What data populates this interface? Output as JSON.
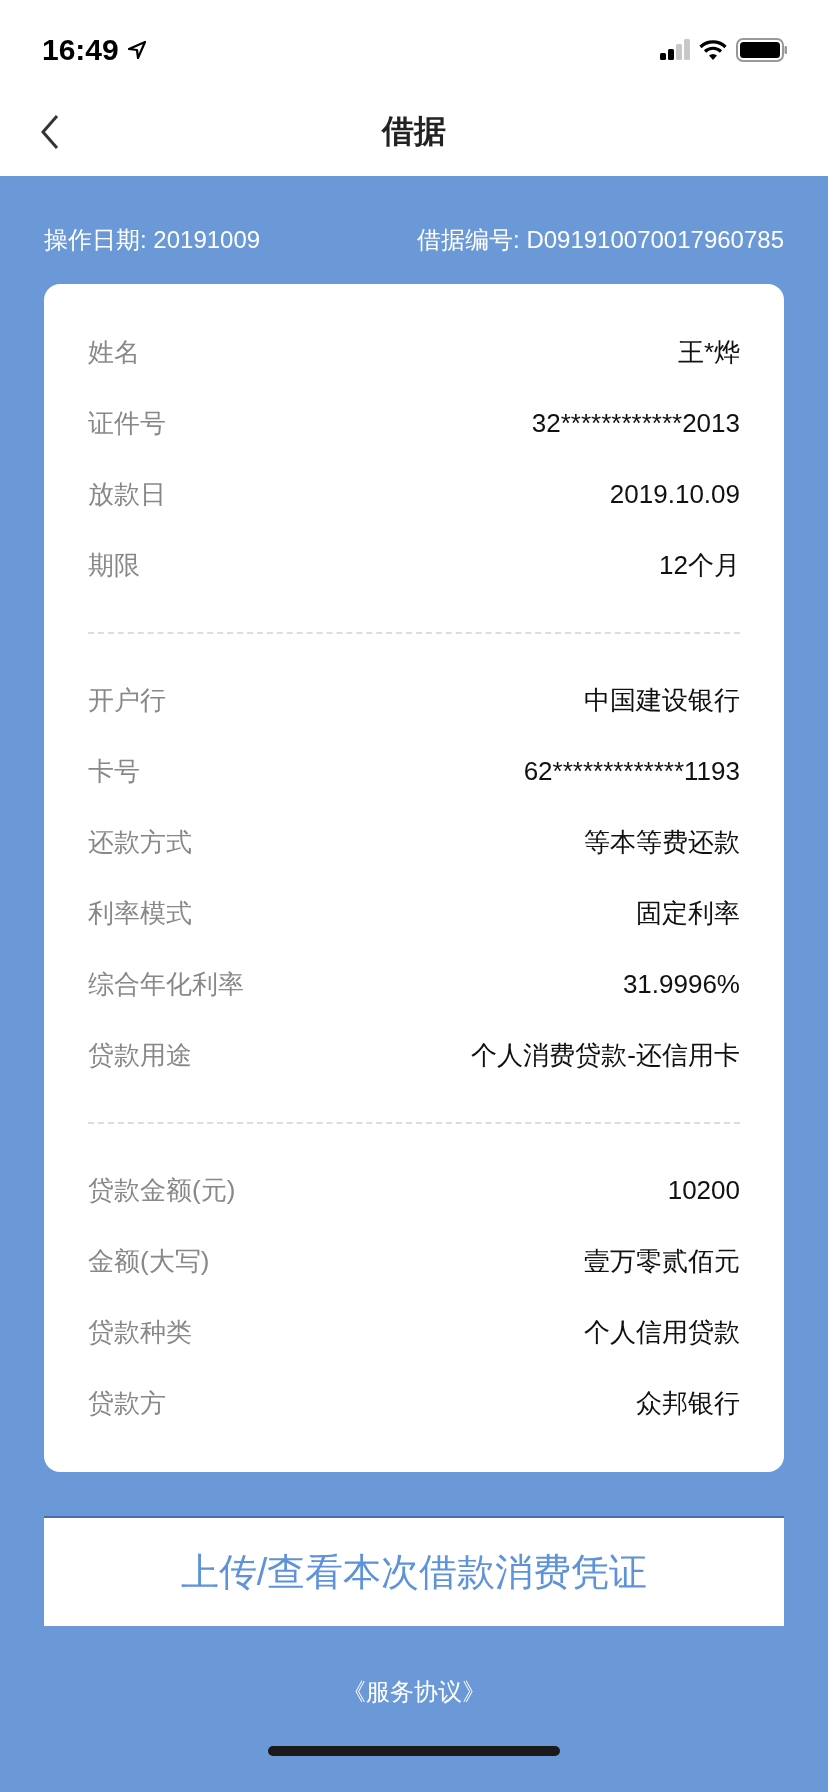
{
  "status_bar": {
    "time": "16:49"
  },
  "nav_bar": {
    "title": "借据"
  },
  "header": {
    "operation_date": "操作日期: 20191009",
    "receipt_number": "借据编号: D091910070017960785"
  },
  "sections": [
    {
      "rows": [
        {
          "label": "姓名",
          "value": "王*烨"
        },
        {
          "label": "证件号",
          "value": "32************2013"
        },
        {
          "label": "放款日",
          "value": "2019.10.09"
        },
        {
          "label": "期限",
          "value": "12个月"
        }
      ]
    },
    {
      "rows": [
        {
          "label": "开户行",
          "value": "中国建设银行"
        },
        {
          "label": "卡号",
          "value": "62*************1193"
        },
        {
          "label": "还款方式",
          "value": "等本等费还款"
        },
        {
          "label": "利率模式",
          "value": "固定利率"
        },
        {
          "label": "综合年化利率",
          "value": "31.9996%"
        },
        {
          "label": "贷款用途",
          "value": "个人消费贷款-还信用卡"
        }
      ]
    },
    {
      "rows": [
        {
          "label": "贷款金额(元)",
          "value": "10200"
        },
        {
          "label": "金额(大写)",
          "value": "壹万零贰佰元"
        },
        {
          "label": "贷款种类",
          "value": "个人信用贷款"
        },
        {
          "label": "贷款方",
          "value": "众邦银行"
        }
      ]
    }
  ],
  "voucher_button": {
    "label": "上传/查看本次借款消费凭证"
  },
  "agreement_link": {
    "label": "《服务协议》"
  }
}
